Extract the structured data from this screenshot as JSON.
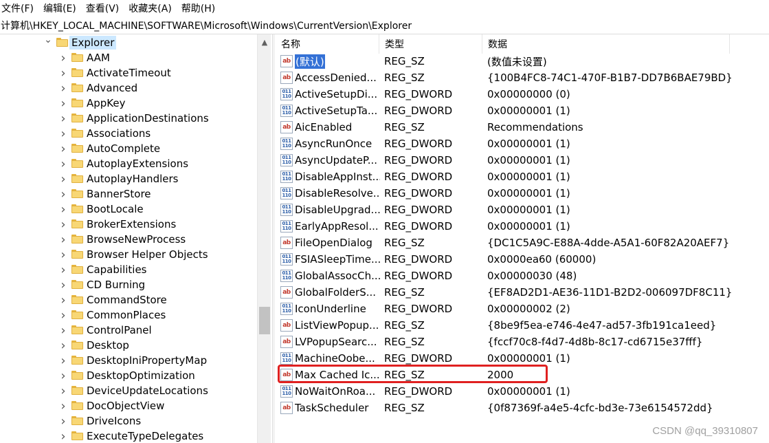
{
  "menu": [
    "文件(F)",
    "编辑(E)",
    "查看(V)",
    "收藏夹(A)",
    "帮助(H)"
  ],
  "address": "计算机\\HKEY_LOCAL_MACHINE\\SOFTWARE\\Microsoft\\Windows\\CurrentVersion\\Explorer",
  "tree": {
    "root": "Explorer",
    "children": [
      "AAM",
      "ActivateTimeout",
      "Advanced",
      "AppKey",
      "ApplicationDestinations",
      "Associations",
      "AutoComplete",
      "AutoplayExtensions",
      "AutoplayHandlers",
      "BannerStore",
      "BootLocale",
      "BrokerExtensions",
      "BrowseNewProcess",
      "Browser Helper Objects",
      "Capabilities",
      "CD Burning",
      "CommandStore",
      "CommonPlaces",
      "ControlPanel",
      "Desktop",
      "DesktopIniPropertyMap",
      "DesktopOptimization",
      "DeviceUpdateLocations",
      "DocObjectView",
      "DriveIcons",
      "ExecuteTypeDelegates"
    ]
  },
  "columns": {
    "name": "名称",
    "type": "类型",
    "data": "数据"
  },
  "values": [
    {
      "icon": "string-value-icon",
      "name": "(默认)",
      "type": "REG_SZ",
      "data": "(数值未设置)"
    },
    {
      "icon": "string-value-icon",
      "name": "AccessDenied...",
      "type": "REG_SZ",
      "data": "{100B4FC8-74C1-470F-B1B7-DD7B6BAE79BD}"
    },
    {
      "icon": "binary-value-icon",
      "name": "ActiveSetupDi...",
      "type": "REG_DWORD",
      "data": "0x00000000 (0)"
    },
    {
      "icon": "binary-value-icon",
      "name": "ActiveSetupTa...",
      "type": "REG_DWORD",
      "data": "0x00000001 (1)"
    },
    {
      "icon": "string-value-icon",
      "name": "AicEnabled",
      "type": "REG_SZ",
      "data": "Recommendations"
    },
    {
      "icon": "binary-value-icon",
      "name": "AsyncRunOnce",
      "type": "REG_DWORD",
      "data": "0x00000001 (1)"
    },
    {
      "icon": "binary-value-icon",
      "name": "AsyncUpdateP...",
      "type": "REG_DWORD",
      "data": "0x00000001 (1)"
    },
    {
      "icon": "binary-value-icon",
      "name": "DisableAppInst...",
      "type": "REG_DWORD",
      "data": "0x00000001 (1)"
    },
    {
      "icon": "binary-value-icon",
      "name": "DisableResolve...",
      "type": "REG_DWORD",
      "data": "0x00000001 (1)"
    },
    {
      "icon": "binary-value-icon",
      "name": "DisableUpgrad...",
      "type": "REG_DWORD",
      "data": "0x00000001 (1)"
    },
    {
      "icon": "binary-value-icon",
      "name": "EarlyAppResol...",
      "type": "REG_DWORD",
      "data": "0x00000001 (1)"
    },
    {
      "icon": "string-value-icon",
      "name": "FileOpenDialog",
      "type": "REG_SZ",
      "data": "{DC1C5A9C-E88A-4dde-A5A1-60F82A20AEF7}"
    },
    {
      "icon": "binary-value-icon",
      "name": "FSIASleepTime...",
      "type": "REG_DWORD",
      "data": "0x0000ea60 (60000)"
    },
    {
      "icon": "binary-value-icon",
      "name": "GlobalAssocCh...",
      "type": "REG_DWORD",
      "data": "0x00000030 (48)"
    },
    {
      "icon": "string-value-icon",
      "name": "GlobalFolderS...",
      "type": "REG_SZ",
      "data": "{EF8AD2D1-AE36-11D1-B2D2-006097DF8C11}"
    },
    {
      "icon": "binary-value-icon",
      "name": "IconUnderline",
      "type": "REG_DWORD",
      "data": "0x00000002 (2)"
    },
    {
      "icon": "string-value-icon",
      "name": "ListViewPopup...",
      "type": "REG_SZ",
      "data": "{8be9f5ea-e746-4e47-ad57-3fb191ca1eed}"
    },
    {
      "icon": "string-value-icon",
      "name": "LVPopupSearc...",
      "type": "REG_SZ",
      "data": "{fccf70c8-f4d7-4d8b-8c17-cd6715e37fff}"
    },
    {
      "icon": "binary-value-icon",
      "name": "MachineOobe...",
      "type": "REG_DWORD",
      "data": "0x00000001 (1)"
    },
    {
      "icon": "string-value-icon",
      "name": "Max Cached Ic...",
      "type": "REG_SZ",
      "data": "2000"
    },
    {
      "icon": "binary-value-icon",
      "name": "NoWaitOnRoa...",
      "type": "REG_DWORD",
      "data": "0x00000001 (1)"
    },
    {
      "icon": "string-value-icon",
      "name": "TaskScheduler",
      "type": "REG_SZ",
      "data": "{0f87369f-a4e5-4cfc-bd3e-73e6154572dd}"
    }
  ],
  "watermark": "CSDN @qq_39310807",
  "colors": {
    "selection": "#3471d6",
    "tree_selection": "#cce8ff",
    "highlight_border": "#e02020"
  }
}
